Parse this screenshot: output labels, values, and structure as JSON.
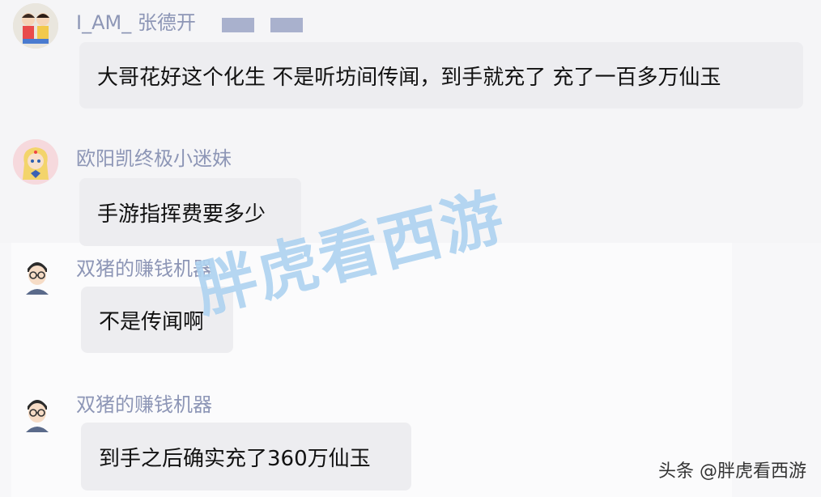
{
  "messages": [
    {
      "sender": "I_AM_ 张德开",
      "text": "大哥花好这个化生 不是听坊间传闻，到手就充了 充了一百多万仙玉",
      "avatar_icon": "kids-avatar-icon"
    },
    {
      "sender": "欧阳凯终极小迷妹",
      "text": "手游指挥费要多少",
      "avatar_icon": "sailor-girl-avatar-icon"
    },
    {
      "sender": "双猪的赚钱机器",
      "text": "不是传闻啊",
      "avatar_icon": "glasses-man-avatar-icon"
    },
    {
      "sender": "双猪的赚钱机器",
      "text": "到手之后确实充了360万仙玉",
      "avatar_icon": "glasses-man-avatar-icon"
    }
  ],
  "watermark": "胖虎看西游",
  "footer": "头条 @胖虎看西游",
  "colors": {
    "name": "#8d96b6",
    "bubble": "#ededf0",
    "watermark": "#78b4e6"
  }
}
